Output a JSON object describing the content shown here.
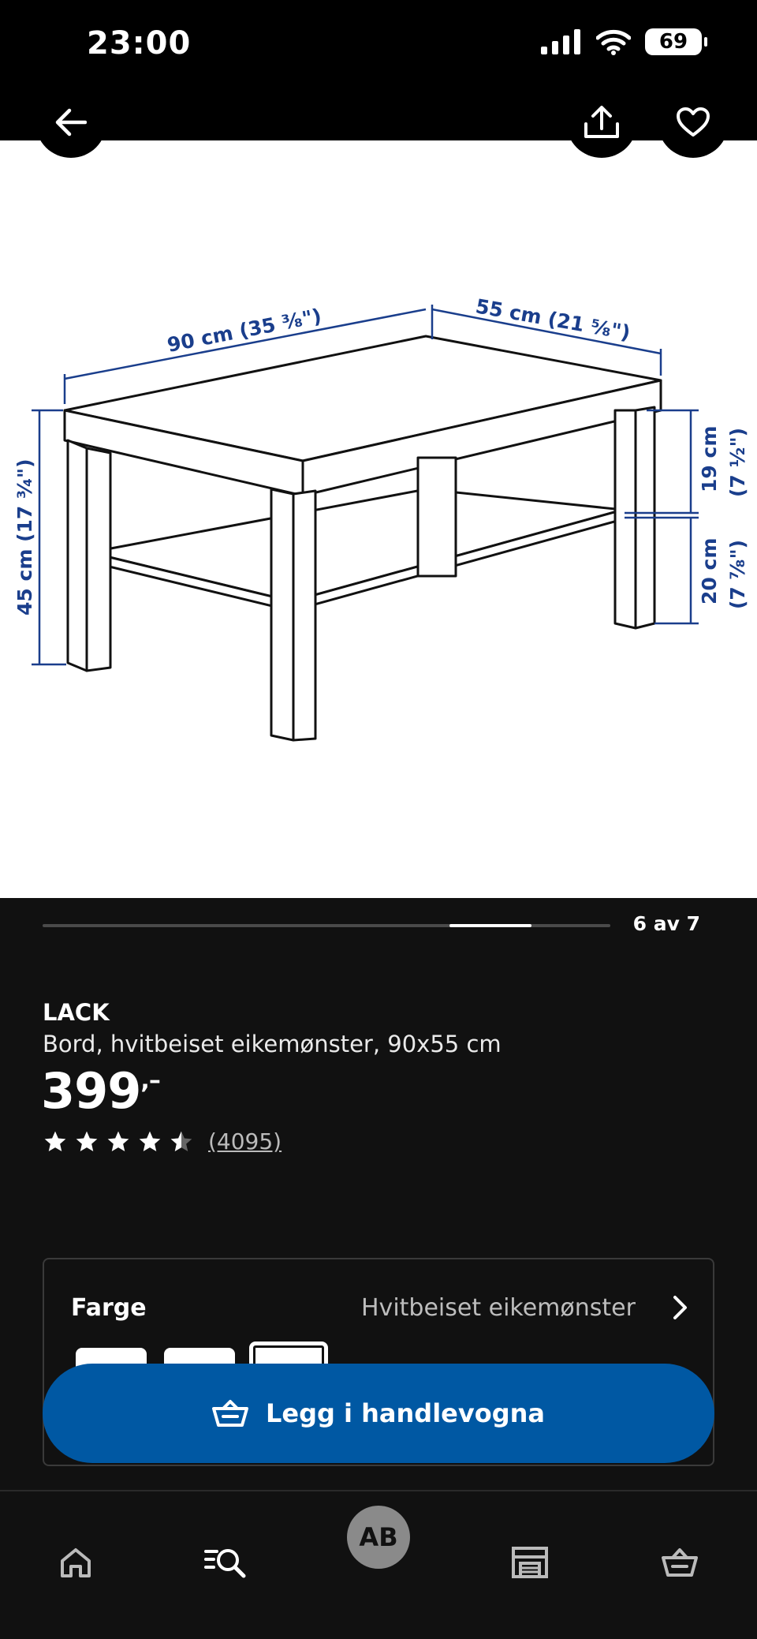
{
  "status_bar": {
    "time": "23:00",
    "battery": "69"
  },
  "image": {
    "dims": {
      "width": "90 cm (35 ³⁄₈\")",
      "depth": "55 cm (21 ⁵⁄₈\")",
      "height": "45 cm (17 ³⁄₄\")",
      "upper_gap_cm": "19 cm",
      "upper_gap_in": "(7 ¹⁄₂\")",
      "lower_gap_cm": "20 cm",
      "lower_gap_in": "(7 ⁷⁄₈\")"
    }
  },
  "carousel": {
    "position_label": "6 av 7",
    "current": 6,
    "total": 7
  },
  "product": {
    "name": "LACK",
    "description": "Bord, hvitbeiset eikemønster, 90x55 cm",
    "price": "399",
    "price_suffix": ",–",
    "rating": 4.5,
    "review_count": "(4095)"
  },
  "color_selector": {
    "label": "Farge",
    "value": "Hvitbeiset eikemønster"
  },
  "cta": {
    "label": "Legg i handlevogna",
    "color": "#0058a3"
  },
  "tab_bar": {
    "items": [
      "home-icon",
      "search-list-icon",
      "profile-avatar",
      "store-icon",
      "basket-icon"
    ],
    "avatar_initials": "AB"
  }
}
